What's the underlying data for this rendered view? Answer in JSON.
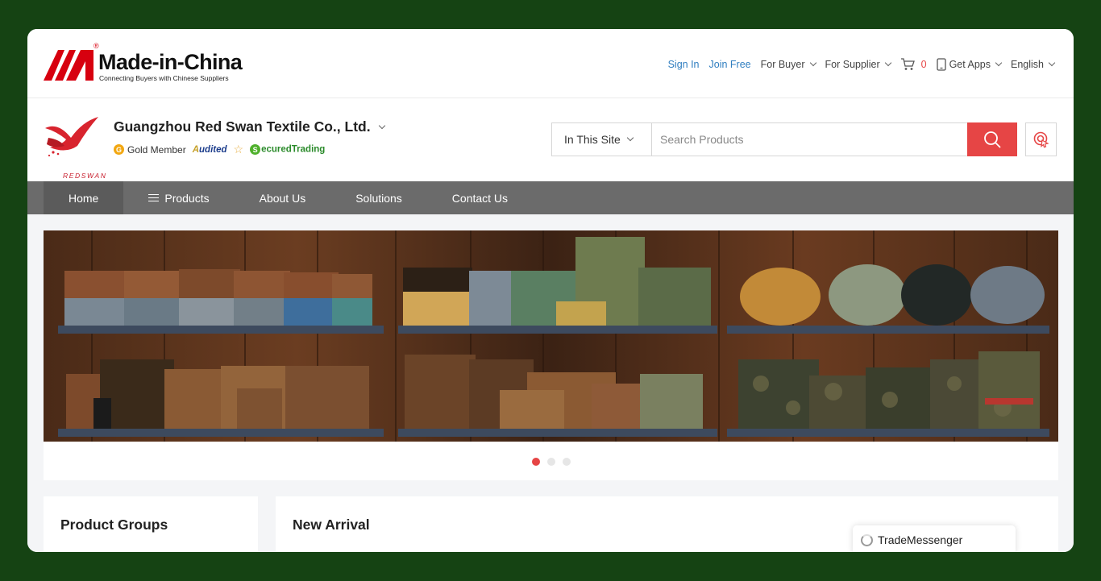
{
  "site": {
    "logo_text": "Made-in-China",
    "logo_tagline": "Connecting Buyers with Chinese Suppliers",
    "registered_mark": "®"
  },
  "top_nav": {
    "sign_in": "Sign In",
    "join_free": "Join Free",
    "for_buyer": "For Buyer",
    "for_supplier": "For Supplier",
    "cart_count": "0",
    "get_apps": "Get Apps",
    "language": "English"
  },
  "company": {
    "logo_text": "REDSWAN",
    "name": "Guangzhou Red Swan Textile Co., Ltd.",
    "gold_icon": "G",
    "gold_member": "Gold Member",
    "audited_a": "A",
    "audited_rest": "udited",
    "secured_s": "S",
    "secured_rest": "ecuredTrading"
  },
  "search": {
    "scope": "In This Site",
    "placeholder": "Search Products"
  },
  "nav": {
    "items": [
      {
        "label": "Home",
        "active": true
      },
      {
        "label": "Products"
      },
      {
        "label": "About Us"
      },
      {
        "label": "Solutions"
      },
      {
        "label": "Contact Us"
      }
    ]
  },
  "carousel": {
    "slide_count": 3,
    "active_index": 0
  },
  "sections": {
    "product_groups": "Product Groups",
    "new_arrival": "New Arrival"
  },
  "trade_messenger": {
    "label": "TradeMessenger"
  },
  "colors": {
    "background": "#154313",
    "accent_red": "#e64545",
    "link_blue": "#2f7ec0",
    "nav_gray": "#6b6b6b"
  }
}
